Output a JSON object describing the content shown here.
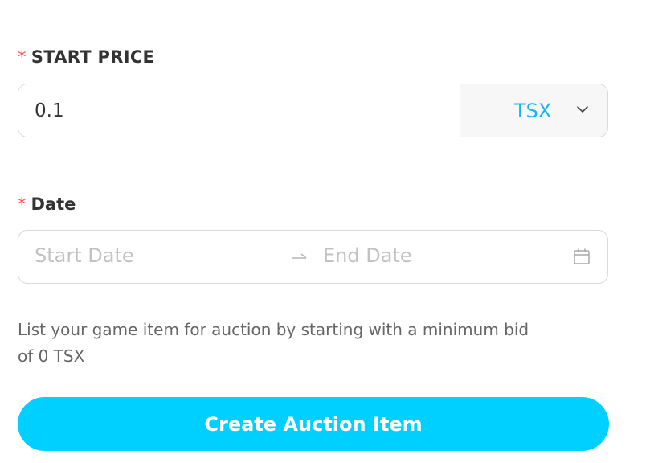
{
  "form": {
    "start_price": {
      "required_mark": "*",
      "label": "START PRICE",
      "value": "0.1",
      "currency": "TSX"
    },
    "date": {
      "required_mark": "*",
      "label": "Date",
      "start_placeholder": "Start Date",
      "end_placeholder": "End Date"
    },
    "helper_text": "List your game item for auction by starting with a minimum bid of 0 TSX",
    "submit_label": "Create Auction Item"
  },
  "colors": {
    "accent": "#00d0ff",
    "currency_text": "#18b4ee",
    "required": "#ff4d4f"
  },
  "icons": [
    "chevron-down-icon",
    "arrow-right-icon",
    "calendar-icon"
  ]
}
